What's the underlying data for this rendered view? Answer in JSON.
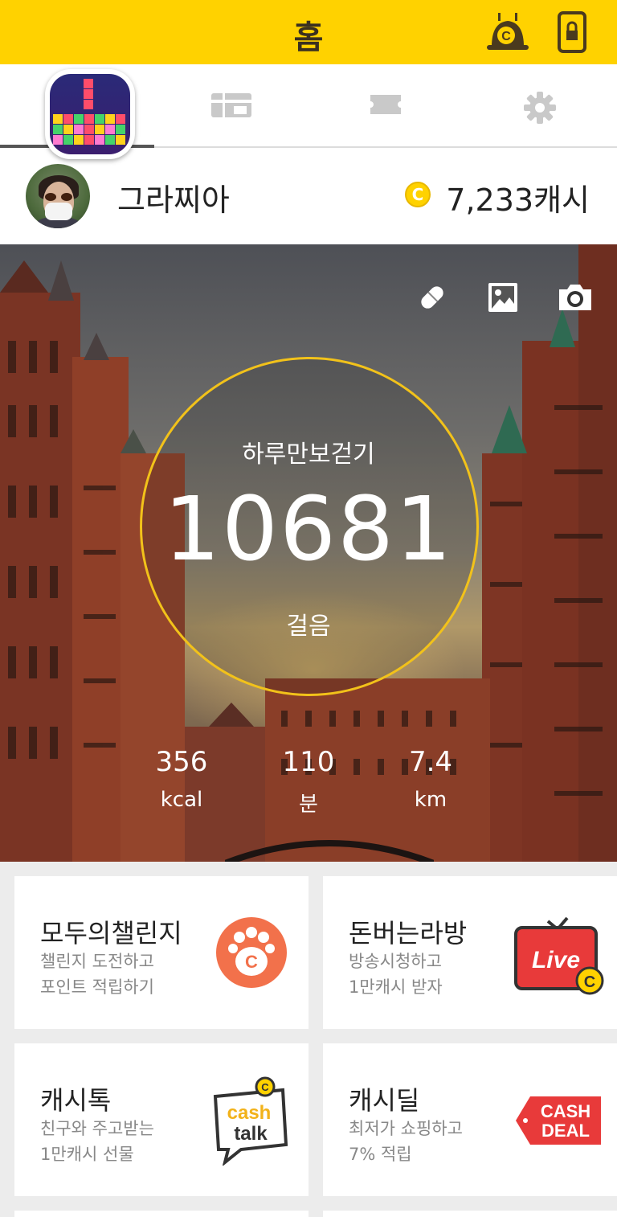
{
  "header": {
    "title": "홈"
  },
  "tabs": [
    {
      "name": "game",
      "active": true
    },
    {
      "name": "gift"
    },
    {
      "name": "ticket"
    },
    {
      "name": "settings"
    }
  ],
  "profile": {
    "username": "그라찌아",
    "coin_symbol": "C",
    "cash": "7,233캐시"
  },
  "hero": {
    "ring_title": "하루만보걷기",
    "steps": "10681",
    "steps_unit": "걸음",
    "stats": [
      {
        "value": "356",
        "unit": "kcal"
      },
      {
        "value": "110",
        "unit": "분"
      },
      {
        "value": "7.4",
        "unit": "km"
      }
    ],
    "ring_color": "#f2c21a"
  },
  "cards": [
    {
      "title": "모두의챌린지",
      "line1": "챌린지 도전하고",
      "line2": "포인트 적립하기",
      "icon": "paw-coin-icon"
    },
    {
      "title": "돈버는라방",
      "line1": "방송시청하고",
      "line2": "1만캐시 받자",
      "icon": "live-tv-icon",
      "icon_text": "Live"
    },
    {
      "title": "캐시톡",
      "line1": "친구와 주고받는",
      "line2": "1만캐시 선물",
      "icon": "cashtalk-icon",
      "icon_text1": "cash",
      "icon_text2": "talk"
    },
    {
      "title": "캐시딜",
      "line1": "최저가 쇼핑하고",
      "line2": "7% 적립",
      "icon": "cashdeal-tag-icon",
      "icon_text1": "CASH",
      "icon_text2": "DEAL"
    }
  ],
  "colors": {
    "brand": "#ffd200",
    "accent_orange": "#f2714b",
    "live_red": "#e83a3a"
  }
}
